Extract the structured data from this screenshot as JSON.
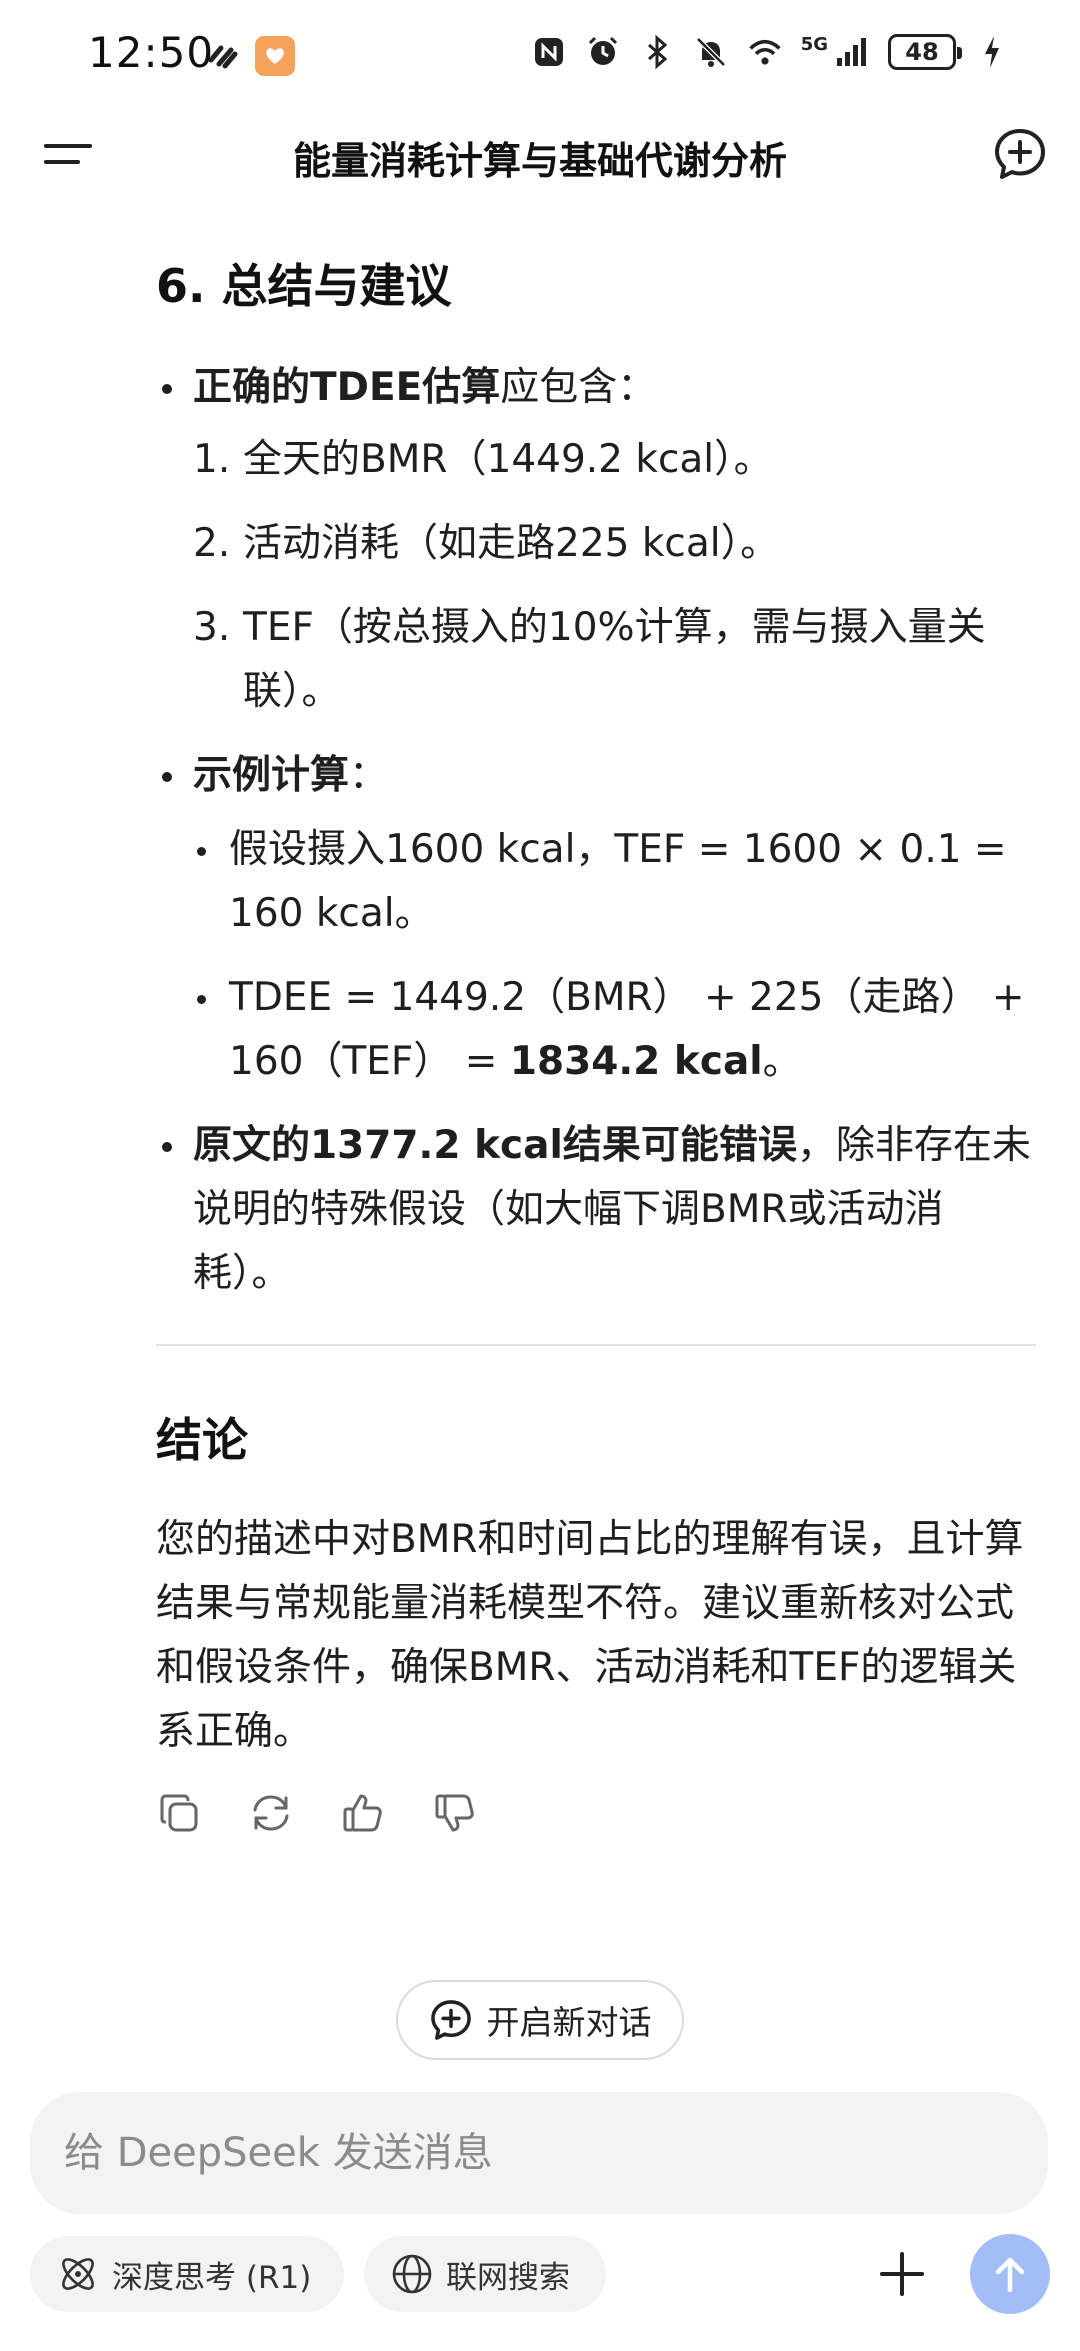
{
  "status_bar": {
    "time": "12:50",
    "network": "5G",
    "battery": "48"
  },
  "header": {
    "title": "能量消耗计算与基础代谢分析"
  },
  "content": {
    "section_title": "6. 总结与建议",
    "bullets": {
      "b1": {
        "bold": "正确的TDEE估算",
        "rest": "应包含："
      },
      "items": [
        {
          "num": "1.",
          "text": "全天的BMR（1449.2 kcal）。"
        },
        {
          "num": "2.",
          "text": "活动消耗（如走路225 kcal）。"
        },
        {
          "num": "3.",
          "text": "TEF（按总摄入的10%计算，需与摄入量关联）。"
        }
      ],
      "b2": {
        "bold": "示例计算",
        "rest": "："
      },
      "sub_items": [
        {
          "text": "假设摄入1600 kcal，TEF = 1600 × 0.1 = 160 kcal。"
        },
        {
          "text": "TDEE = 1449.2（BMR） + 225（走路） + 160（TEF） = ",
          "bold": "1834.2 kcal",
          "tail": "。"
        }
      ],
      "b3": {
        "bold": "原文的1377.2 kcal结果可能错误",
        "rest": "，除非存在未说明的特殊假设（如大幅下调BMR或活动消耗）。"
      }
    },
    "conclusion_title": "结论",
    "conclusion_text": "您的描述中对BMR和时间占比的理解有误，且计算结果与常规能量消耗模型不符。建议重新核对公式和假设条件，确保BMR、活动消耗和TEF的逻辑关系正确。"
  },
  "new_conversation": {
    "label": "开启新对话"
  },
  "composer": {
    "placeholder": "给 DeepSeek 发送消息"
  },
  "toolbar": {
    "deep_think_label": "深度思考 (R1)",
    "web_search_label": "联网搜索"
  },
  "colors": {
    "send_button": "#a3bdf7",
    "composer_bg": "#f3f3f4",
    "app_badge": "#f5a35c"
  }
}
